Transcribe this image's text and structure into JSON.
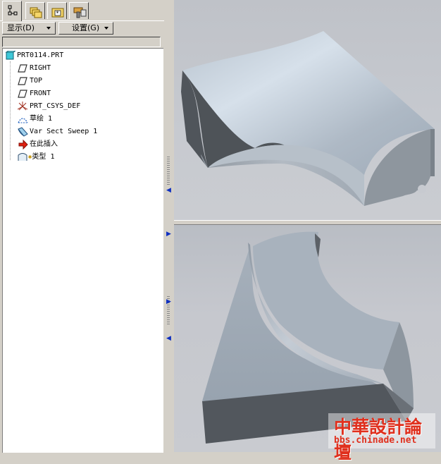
{
  "toolbar": {
    "display_label": "显示(D)",
    "settings_label": "设置(G)"
  },
  "nav_tabs": [
    {
      "icon": "model-tree-icon"
    },
    {
      "icon": "folder-browser-icon"
    },
    {
      "icon": "favorites-icon"
    },
    {
      "icon": "connections-icon"
    }
  ],
  "model_tree": {
    "items": [
      {
        "label": "PRT0114.PRT",
        "icon": "part-icon"
      },
      {
        "label": "RIGHT",
        "icon": "datum-plane-icon"
      },
      {
        "label": "TOP",
        "icon": "datum-plane-icon"
      },
      {
        "label": "FRONT",
        "icon": "datum-plane-icon"
      },
      {
        "label": "PRT_CSYS_DEF",
        "icon": "csys-icon"
      },
      {
        "label": "草绘 1",
        "icon": "sketch-icon"
      },
      {
        "label": "Var Sect Sweep 1",
        "icon": "sweep-icon"
      },
      {
        "label": "在此插入",
        "icon": "insert-here-arrow-icon"
      },
      {
        "label": "类型 1",
        "icon": "type-feature-icon"
      }
    ]
  },
  "watermark": {
    "title": "中華設計論壇",
    "url": "bbs.chinade.net"
  },
  "colors": {
    "panel": "#d4d0c8",
    "tree_bg": "#ffffff",
    "viewport_bg": "#c6c9cf",
    "model_face": "#aab4c0",
    "model_dark_face": "#565a60",
    "watermark_red": "#e0301e"
  }
}
